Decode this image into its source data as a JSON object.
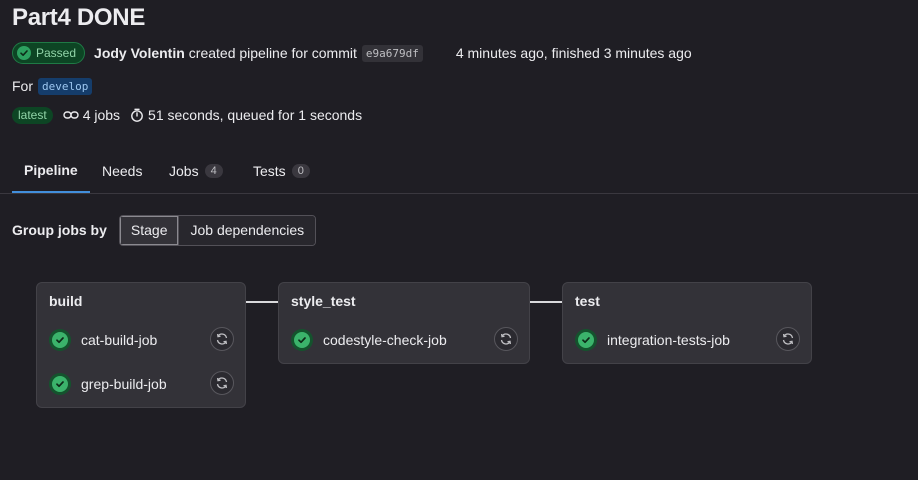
{
  "page": {
    "title": "Part4 DONE"
  },
  "pipeline": {
    "status_label": "Passed",
    "author": "Jody Volentin",
    "action_text": "created pipeline for commit",
    "commit_sha": "e9a679df",
    "time_text": "4 minutes ago, finished 3 minutes ago",
    "for_label": "For",
    "ref": "develop",
    "latest_label": "latest",
    "jobs_text": "4 jobs",
    "duration_text": "51 seconds, queued for 1 seconds"
  },
  "tabs": [
    {
      "label": "Pipeline",
      "active": true
    },
    {
      "label": "Needs"
    },
    {
      "label": "Jobs",
      "count": "4"
    },
    {
      "label": "Tests",
      "count": "0"
    }
  ],
  "group_by": {
    "label": "Group jobs by",
    "options": [
      "Stage",
      "Job dependencies"
    ],
    "selected": "Stage"
  },
  "stages": [
    {
      "name": "build",
      "jobs": [
        {
          "name": "cat-build-job"
        },
        {
          "name": "grep-build-job"
        }
      ]
    },
    {
      "name": "style_test",
      "jobs": [
        {
          "name": "codestyle-check-job"
        }
      ]
    },
    {
      "name": "test",
      "jobs": [
        {
          "name": "integration-tests-job"
        }
      ]
    }
  ],
  "colors": {
    "success": "#3bb36b",
    "tab_active_underline": "#428fdc",
    "background": "#1f1e24"
  },
  "icons": {
    "status": "check-circle-icon",
    "jobs": "link-icon",
    "duration": "timer-icon",
    "retry": "retry-icon"
  }
}
